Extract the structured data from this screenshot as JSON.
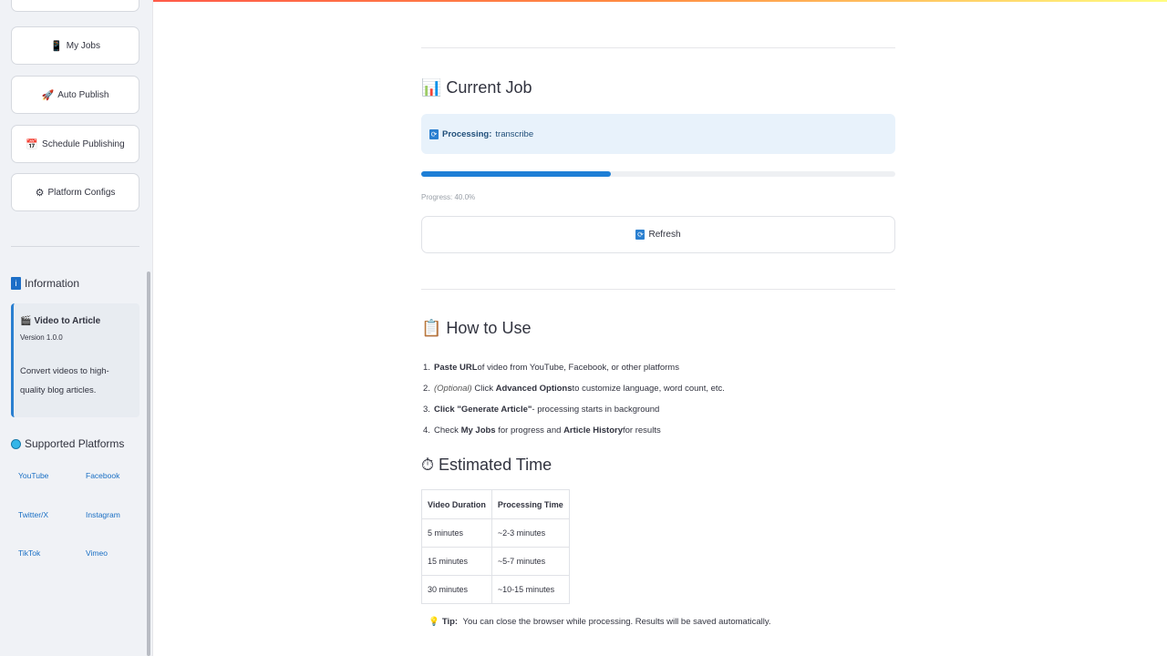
{
  "sidebar": {
    "nav": [
      {
        "label": "My Jobs",
        "icon": "📱"
      },
      {
        "label": "Auto Publish",
        "icon": "🚀"
      },
      {
        "label": "Schedule Publishing",
        "icon": "📅"
      },
      {
        "label": "Platform Configs",
        "icon": "⚙"
      }
    ],
    "information_heading": "Information",
    "info_icon": "i",
    "app": {
      "icon": "🎬",
      "name": "Video to Article",
      "version": "Version 1.0.0",
      "description": "Convert videos to high-quality blog articles."
    },
    "platforms_heading": "Supported Platforms",
    "platforms": [
      "YouTube",
      "Facebook",
      "Twitter/X",
      "Instagram",
      "TikTok",
      "Vimeo"
    ]
  },
  "current_job": {
    "icon": "📊",
    "heading": "Current Job",
    "status_label": "Processing:",
    "status_value": "transcribe",
    "sync_icon": "⟳",
    "progress_fraction": 0.4,
    "progress_text": "Progress: 40.0%",
    "refresh_label": "Refresh"
  },
  "how_to_use": {
    "icon": "📋",
    "heading": "How to Use",
    "steps": [
      {
        "num": "1.",
        "pre": "",
        "bold": "Paste URL",
        "mid": " of video from YouTube, Facebook, or other platforms",
        "bold2": "",
        "post": ""
      },
      {
        "num": "2.",
        "italic": "(Optional)",
        "pre": " Click ",
        "bold": "Advanced Options",
        "mid": " to customize language, word count, etc.",
        "bold2": "",
        "post": ""
      },
      {
        "num": "3.",
        "pre": "",
        "bold": "Click \"Generate Article\"",
        "mid": " - processing starts in background",
        "bold2": "",
        "post": ""
      },
      {
        "num": "4.",
        "pre": "Check ",
        "bold": "My Jobs",
        "mid": " for progress and ",
        "bold2": "Article History",
        "post": " for results"
      }
    ]
  },
  "estimated_time": {
    "icon": "⏱",
    "heading": "Estimated Time",
    "columns": [
      "Video Duration",
      "Processing Time"
    ],
    "rows": [
      [
        "5 minutes",
        "~2-3 minutes"
      ],
      [
        "15 minutes",
        "~5-7 minutes"
      ],
      [
        "30 minutes",
        "~10-15 minutes"
      ]
    ]
  },
  "tip": {
    "icon": "💡",
    "label": "Tip:",
    "text": " You can close the browser while processing. Results will be saved automatically."
  },
  "colors": {
    "accent": "#1e7fd6",
    "info_bg": "#e8f2fb",
    "sidebar_bg": "#f0f2f6"
  }
}
